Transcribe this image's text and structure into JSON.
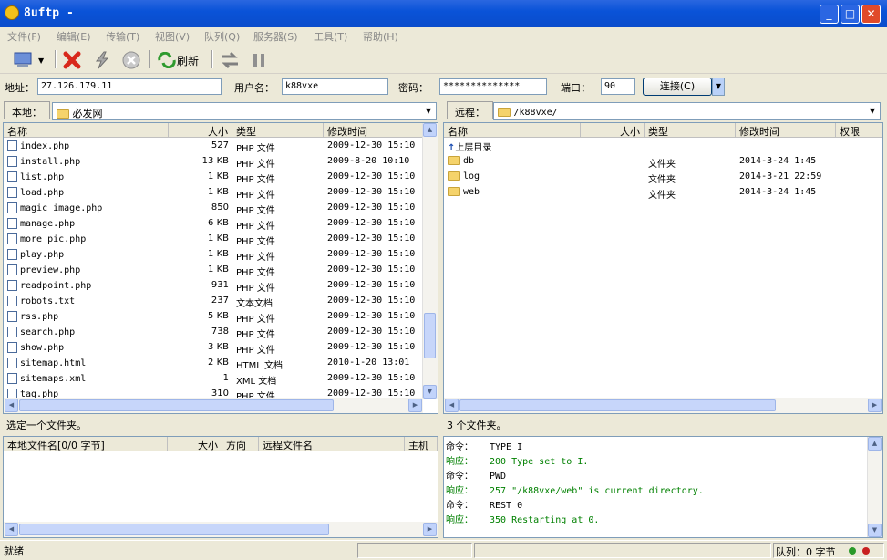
{
  "window": {
    "title": "8uftp -",
    "min": "_",
    "max": "□",
    "close": "✕"
  },
  "menu": [
    "文件(F)",
    "编辑(E)",
    "传输(T)",
    "视图(V)",
    "队列(Q)",
    "服务器(S)",
    "工具(T)",
    "帮助(H)"
  ],
  "toolbar": {
    "refresh": "刷新"
  },
  "conn": {
    "address_label": "地址：",
    "address": "27.126.179.11",
    "user_label": "用户名：",
    "user": "k88vxe",
    "pass_label": "密码：",
    "pass": "**************",
    "port_label": "端口：",
    "port": "90",
    "connect": "连接(C)"
  },
  "local": {
    "label": "本地：",
    "path": "必发网",
    "headers": [
      "名称",
      "大小",
      "类型",
      "修改时间"
    ],
    "rows": [
      [
        "index.php",
        "527",
        "PHP 文件",
        "2009-12-30 15:10"
      ],
      [
        "install.php",
        "13 KB",
        "PHP 文件",
        "2009-8-20 10:10"
      ],
      [
        "list.php",
        "1 KB",
        "PHP 文件",
        "2009-12-30 15:10"
      ],
      [
        "load.php",
        "1 KB",
        "PHP 文件",
        "2009-12-30 15:10"
      ],
      [
        "magic_image.php",
        "850",
        "PHP 文件",
        "2009-12-30 15:10"
      ],
      [
        "manage.php",
        "6 KB",
        "PHP 文件",
        "2009-12-30 15:10"
      ],
      [
        "more_pic.php",
        "1 KB",
        "PHP 文件",
        "2009-12-30 15:10"
      ],
      [
        "play.php",
        "1 KB",
        "PHP 文件",
        "2009-12-30 15:10"
      ],
      [
        "preview.php",
        "1 KB",
        "PHP 文件",
        "2009-12-30 15:10"
      ],
      [
        "readpoint.php",
        "931",
        "PHP 文件",
        "2009-12-30 15:10"
      ],
      [
        "robots.txt",
        "237",
        "文本文档",
        "2009-12-30 15:10"
      ],
      [
        "rss.php",
        "5 KB",
        "PHP 文件",
        "2009-12-30 15:10"
      ],
      [
        "search.php",
        "738",
        "PHP 文件",
        "2009-12-30 15:10"
      ],
      [
        "show.php",
        "3 KB",
        "PHP 文件",
        "2009-12-30 15:10"
      ],
      [
        "sitemap.html",
        "2 KB",
        "HTML 文档",
        "2010-1-20 13:01"
      ],
      [
        "sitemaps.xml",
        "1",
        "XML 文档",
        "2009-12-30 15:10"
      ],
      [
        "tag.php",
        "310",
        "PHP 文件",
        "2009-12-30 15:10"
      ]
    ],
    "status": "选定一个文件夹。"
  },
  "remote": {
    "label": "远程：",
    "path": "/k88vxe/",
    "headers": [
      "名称",
      "大小",
      "类型",
      "修改时间",
      "权限"
    ],
    "up": "上层目录",
    "rows": [
      [
        "db",
        "",
        "文件夹",
        "2014-3-24 1:45"
      ],
      [
        "log",
        "",
        "文件夹",
        "2014-3-21 22:59"
      ],
      [
        "web",
        "",
        "文件夹",
        "2014-3-24 1:45"
      ]
    ],
    "status": "3 个文件夹。"
  },
  "queue": {
    "headers": [
      "本地文件名[0/0 字节]",
      "大小",
      "方向",
      "远程文件名",
      "主机"
    ]
  },
  "log": [
    [
      "命令：",
      "TYPE I",
      "cmd"
    ],
    [
      "响应：",
      "200 Type set to I.",
      "resp"
    ],
    [
      "命令：",
      "PWD",
      "cmd"
    ],
    [
      "响应：",
      "257 \"/k88vxe/web\" is current directory.",
      "resp"
    ],
    [
      "命令：",
      "REST 0",
      "cmd"
    ],
    [
      "响应：",
      "350 Restarting at 0.",
      "resp"
    ]
  ],
  "statusbar": {
    "ready": "就绪",
    "queue": "队列：0 字节"
  },
  "colors": {
    "titlebar": "#0A53D8",
    "response": "#008000"
  }
}
